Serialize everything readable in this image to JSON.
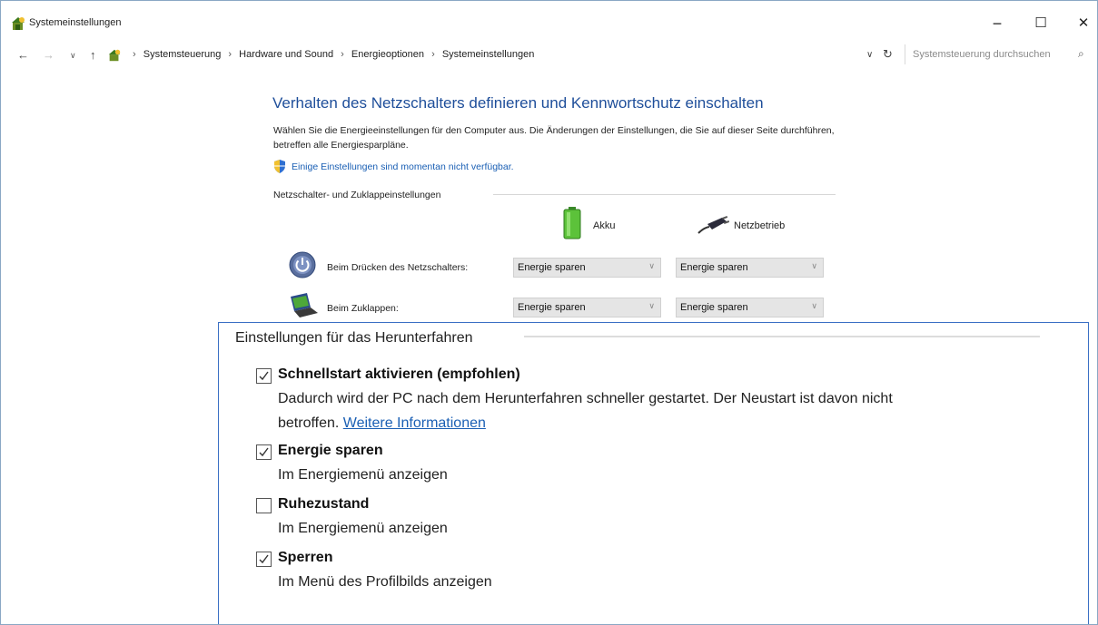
{
  "window": {
    "title": "Systemeinstellungen",
    "minimize": "−",
    "maximize": "☐",
    "close": "✕"
  },
  "address": {
    "back": "←",
    "forward": "→",
    "recent": "∨",
    "up": "↑",
    "breadcrumbs": [
      "Systemsteuerung",
      "Hardware und Sound",
      "Energieoptionen",
      "Systemeinstellungen"
    ],
    "separator": "›",
    "dropdown": "∨",
    "refresh": "↻",
    "search_placeholder": "Systemsteuerung durchsuchen",
    "search_icon": "⌕"
  },
  "main": {
    "heading": "Verhalten des Netzschalters definieren und Kennwortschutz einschalten",
    "description": "Wählen Sie die Energieeinstellungen für den Computer aus. Die Änderungen der Einstellungen, die Sie auf dieser Seite durchführen, betreffen alle Energiesparpläne.",
    "admin_link": "Einige Einstellungen sind momentan nicht verfügbar.",
    "group_label": "Netzschalter- und Zuklappeinstellungen",
    "columns": {
      "battery": "Akku",
      "plugged": "Netzbetrieb"
    },
    "rows": [
      {
        "label": "Beim Drücken des Netzschalters:",
        "battery": "Energie sparen",
        "plugged": "Energie sparen"
      },
      {
        "label": "Beim Zuklappen:",
        "battery": "Energie sparen",
        "plugged": "Energie sparen"
      }
    ]
  },
  "shutdown": {
    "title": "Einstellungen für das Herunterfahren",
    "options": [
      {
        "label": "Schnellstart aktivieren (empfohlen)",
        "checked": true,
        "desc_line1": "Dadurch wird der PC nach dem Herunterfahren schneller gestartet. Der Neustart ist davon nicht",
        "desc_line2": "betroffen.",
        "link": "Weitere Informationen"
      },
      {
        "label": "Energie sparen",
        "checked": true,
        "desc": "Im Energiemenü anzeigen"
      },
      {
        "label": "Ruhezustand",
        "checked": false,
        "desc": "Im Energiemenü anzeigen"
      },
      {
        "label": "Sperren",
        "checked": true,
        "desc": "Im Menü des Profilbilds anzeigen"
      }
    ]
  },
  "colors": {
    "heading": "#1e4e9a",
    "link": "#1a5fb4",
    "panel_border": "#3a6fc4",
    "select_bg": "#e5e5e5"
  },
  "icons": {
    "app": "control-panel-icon",
    "shield": "uac-shield-icon",
    "battery": "battery-icon",
    "plug": "power-plug-icon",
    "power_button": "power-button-icon",
    "lid": "laptop-lid-icon"
  }
}
